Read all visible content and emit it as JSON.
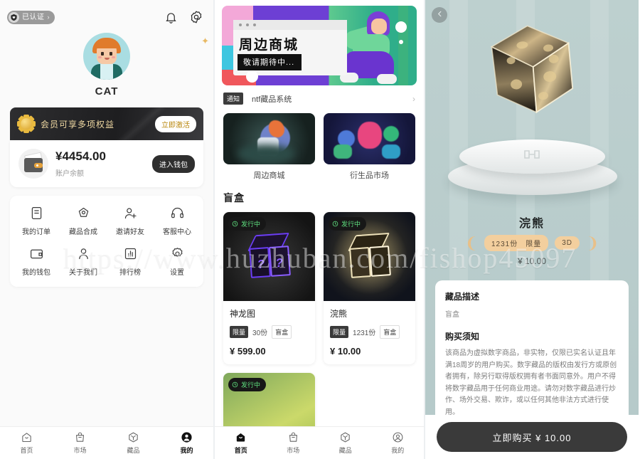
{
  "profile": {
    "verified_badge": "已认证",
    "verified_chevron": "›",
    "bell_icon": "bell-icon",
    "gear_icon": "gear-icon",
    "username": "CAT",
    "member_banner_text": "会员可享多项权益",
    "member_activate_label": "立即激活",
    "wallet_amount": "¥4454.00",
    "wallet_label": "账户余额",
    "wallet_button": "进入钱包",
    "menu": [
      {
        "label": "我的订单",
        "icon": "order-icon"
      },
      {
        "label": "藏品合成",
        "icon": "compose-icon"
      },
      {
        "label": "邀请好友",
        "icon": "invite-friend-icon"
      },
      {
        "label": "客服中心",
        "icon": "headset-icon"
      },
      {
        "label": "我的钱包",
        "icon": "wallet-icon"
      },
      {
        "label": "关于我们",
        "icon": "person-icon"
      },
      {
        "label": "排行榜",
        "icon": "chart-icon"
      },
      {
        "label": "设置",
        "icon": "settings-icon"
      }
    ]
  },
  "tabbar": {
    "items": [
      {
        "label": "首页",
        "icon": "home-icon"
      },
      {
        "label": "市场",
        "icon": "market-icon"
      },
      {
        "label": "藏品",
        "icon": "collection-icon"
      },
      {
        "label": "我的",
        "icon": "profile-icon"
      }
    ],
    "active_profile": "我的",
    "active_home": "首页"
  },
  "home": {
    "banner": {
      "title": "周边商城",
      "subtitle": "敬请期待中..."
    },
    "notice": {
      "badge": "通知",
      "text": "ntf藏品系统",
      "chevron": "›"
    },
    "categories": [
      {
        "label": "周边商城"
      },
      {
        "label": "衍生品市场"
      }
    ],
    "section_title": "盲盒",
    "boxes": [
      {
        "status": "发行中",
        "name": "神龙图",
        "limit_tag": "限量",
        "qty": "30份",
        "type_tag": "盲盒",
        "price": "¥ 599.00"
      },
      {
        "status": "发行中",
        "name": "浣熊",
        "limit_tag": "限量",
        "qty": "1231份",
        "type_tag": "盲盒",
        "price": "¥ 10.00"
      },
      {
        "status": "发行中",
        "name": "",
        "limit_tag": "",
        "qty": "",
        "type_tag": "",
        "price": ""
      }
    ]
  },
  "detail": {
    "back_icon": "chevron-left-icon",
    "title": "浣熊",
    "tag_qty": "1231份",
    "tag_limit": "限量",
    "tag_3d": "3D",
    "price": "¥ 10.00",
    "desc_heading": "藏品描述",
    "desc_text": "盲盒",
    "notice_heading": "购买须知",
    "notice_text": "该商品为虚拟数字商品，非实物，仅限已实名认证且年满18周岁的用户购买。数字藏品的版权由发行方或原创者拥有，除另行取得版权拥有者书面同意外。用户不得将数字藏品用于任何商业用途。请勿对数字藏品进行炒作、场外交易、欺诈，或以任何其他非法方式进行使用。",
    "buy_button": "立即购买 ¥ 10.00"
  },
  "watermark": "https://www.huzhuban.com/fishop45097",
  "colors": {
    "accent_gold": "#f0d9a3",
    "status_green": "#5fe07f",
    "detail_bg": "#b8cccb",
    "tag_peach": "#f3cf9e",
    "dark": "#3a3a3a"
  }
}
